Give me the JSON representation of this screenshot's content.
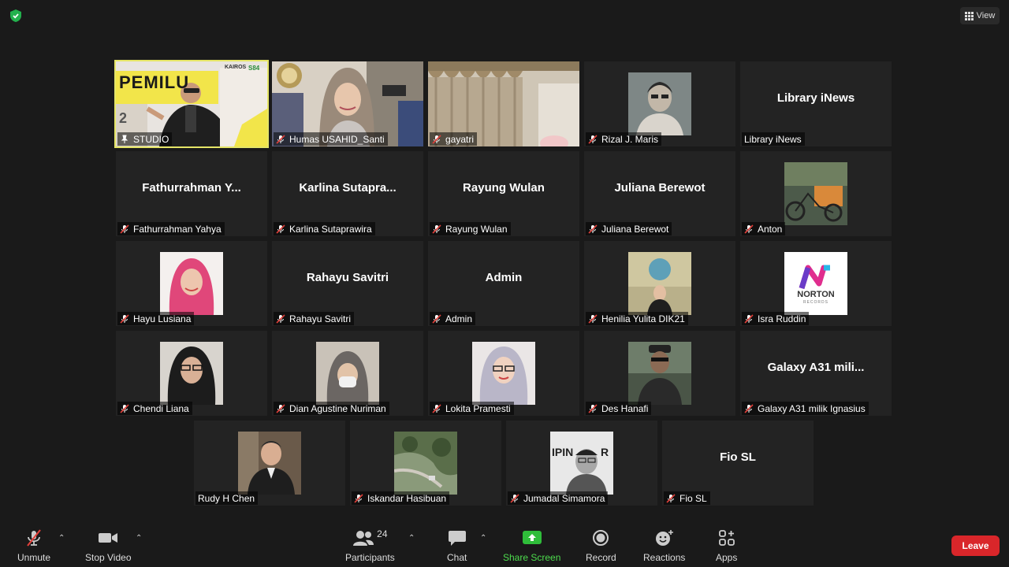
{
  "header": {
    "view_label": "View"
  },
  "tiles": [
    {
      "label": "STUDIO"
    },
    {
      "label": "Humas USAHID_Santi"
    },
    {
      "label": "gayatri"
    },
    {
      "label": "Rizal  J. Maris"
    },
    {
      "label": "Library iNews",
      "display": "Library iNews"
    },
    {
      "label": "Fathurrahman Yahya",
      "display": "Fathurrahman Y..."
    },
    {
      "label": "Karlina Sutaprawira",
      "display": "Karlina  Sutapra..."
    },
    {
      "label": "Rayung Wulan",
      "display": "Rayung Wulan"
    },
    {
      "label": "Juliana Berewot",
      "display": "Juliana Berewot"
    },
    {
      "label": "Anton"
    },
    {
      "label": "Hayu Lusiana"
    },
    {
      "label": "Rahayu Savitri",
      "display": "Rahayu Savitri"
    },
    {
      "label": "Admin",
      "display": "Admin"
    },
    {
      "label": "Henilia Yulita DIK21"
    },
    {
      "label": "Isra Ruddin"
    },
    {
      "label": "Chendi Liana"
    },
    {
      "label": "Dian Agustine Nuriman"
    },
    {
      "label": "Lokita Pramesti"
    },
    {
      "label": "Des Hanafi"
    },
    {
      "label": "Galaxy A31 milik Ignasius",
      "display": "Galaxy A31 mili..."
    },
    {
      "label": "Rudy H Chen"
    },
    {
      "label": "Iskandar Hasibuan"
    },
    {
      "label": "Jumadal Simamora"
    },
    {
      "label": "Fio SL",
      "display": "Fio SL"
    }
  ],
  "video_text": {
    "studio_banner": "PEMILU",
    "studio_num": "2",
    "studio_logo1": "KAIROS",
    "studio_logo2": "S84",
    "norton": "NORTON",
    "norton_sub": "RECORDS",
    "jumadal_sign": "IPIN",
    "jumadal_sign2": "R"
  },
  "toolbar": {
    "unmute": "Unmute",
    "stop_video": "Stop Video",
    "participants": "Participants",
    "participants_count": "24",
    "chat": "Chat",
    "share_screen": "Share Screen",
    "record": "Record",
    "reactions": "Reactions",
    "apps": "Apps",
    "leave": "Leave"
  },
  "colors": {
    "active_speaker": "#e5e567",
    "share_green": "#4ddc4d",
    "leave_red": "#d9262a",
    "mic_off_red": "#e0403a",
    "shield_green": "#23b14d"
  }
}
